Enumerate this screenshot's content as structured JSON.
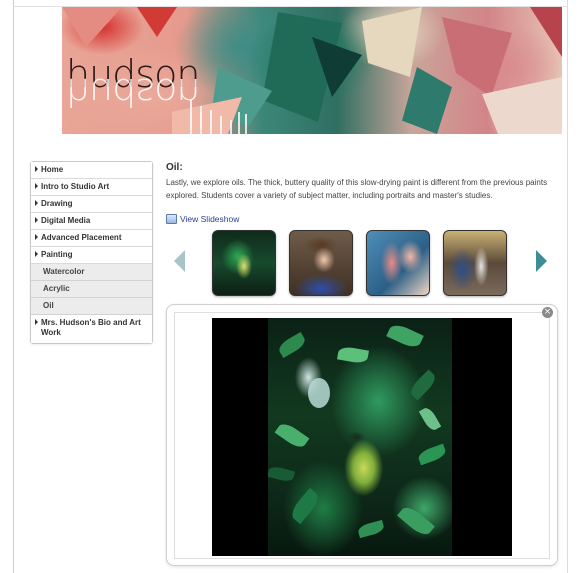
{
  "site": {
    "banner_title": "hudson",
    "banner_alt": "hudson"
  },
  "nav": {
    "items": [
      {
        "label": "Home"
      },
      {
        "label": "Intro to Studio Art"
      },
      {
        "label": "Drawing"
      },
      {
        "label": "Digital Media"
      },
      {
        "label": "Advanced Placement"
      },
      {
        "label": "Painting"
      }
    ],
    "subitems": [
      {
        "label": "Watercolor"
      },
      {
        "label": "Acrylic"
      },
      {
        "label": "Oil"
      }
    ],
    "last_item": {
      "label": "Mrs. Hudson's Bio and Art Work"
    }
  },
  "content": {
    "heading": "Oil:",
    "description": "Lastly, we explore oils. The thick, buttery quality of this slow-drying paint is different from the previous paints explored. Students cover a variety of subject matter, including portraits and master's studies.",
    "slideshow_label": "View Slideshow"
  },
  "gallery": {
    "thumbnails": [
      {
        "subject": "green-foliage-portrait"
      },
      {
        "subject": "child-portrait"
      },
      {
        "subject": "hand-study"
      },
      {
        "subject": "figure-study"
      }
    ],
    "close_symbol": "×",
    "selected_image": "green-foliage-portrait"
  },
  "icons": {
    "prev": "arrow-left-icon",
    "next": "arrow-right-icon",
    "close": "close-icon",
    "slideshow": "slideshow-icon"
  },
  "colors": {
    "link": "#2a3f8c",
    "arrow_active": "#3d8d97",
    "arrow_inactive": "#a9c4c9"
  }
}
